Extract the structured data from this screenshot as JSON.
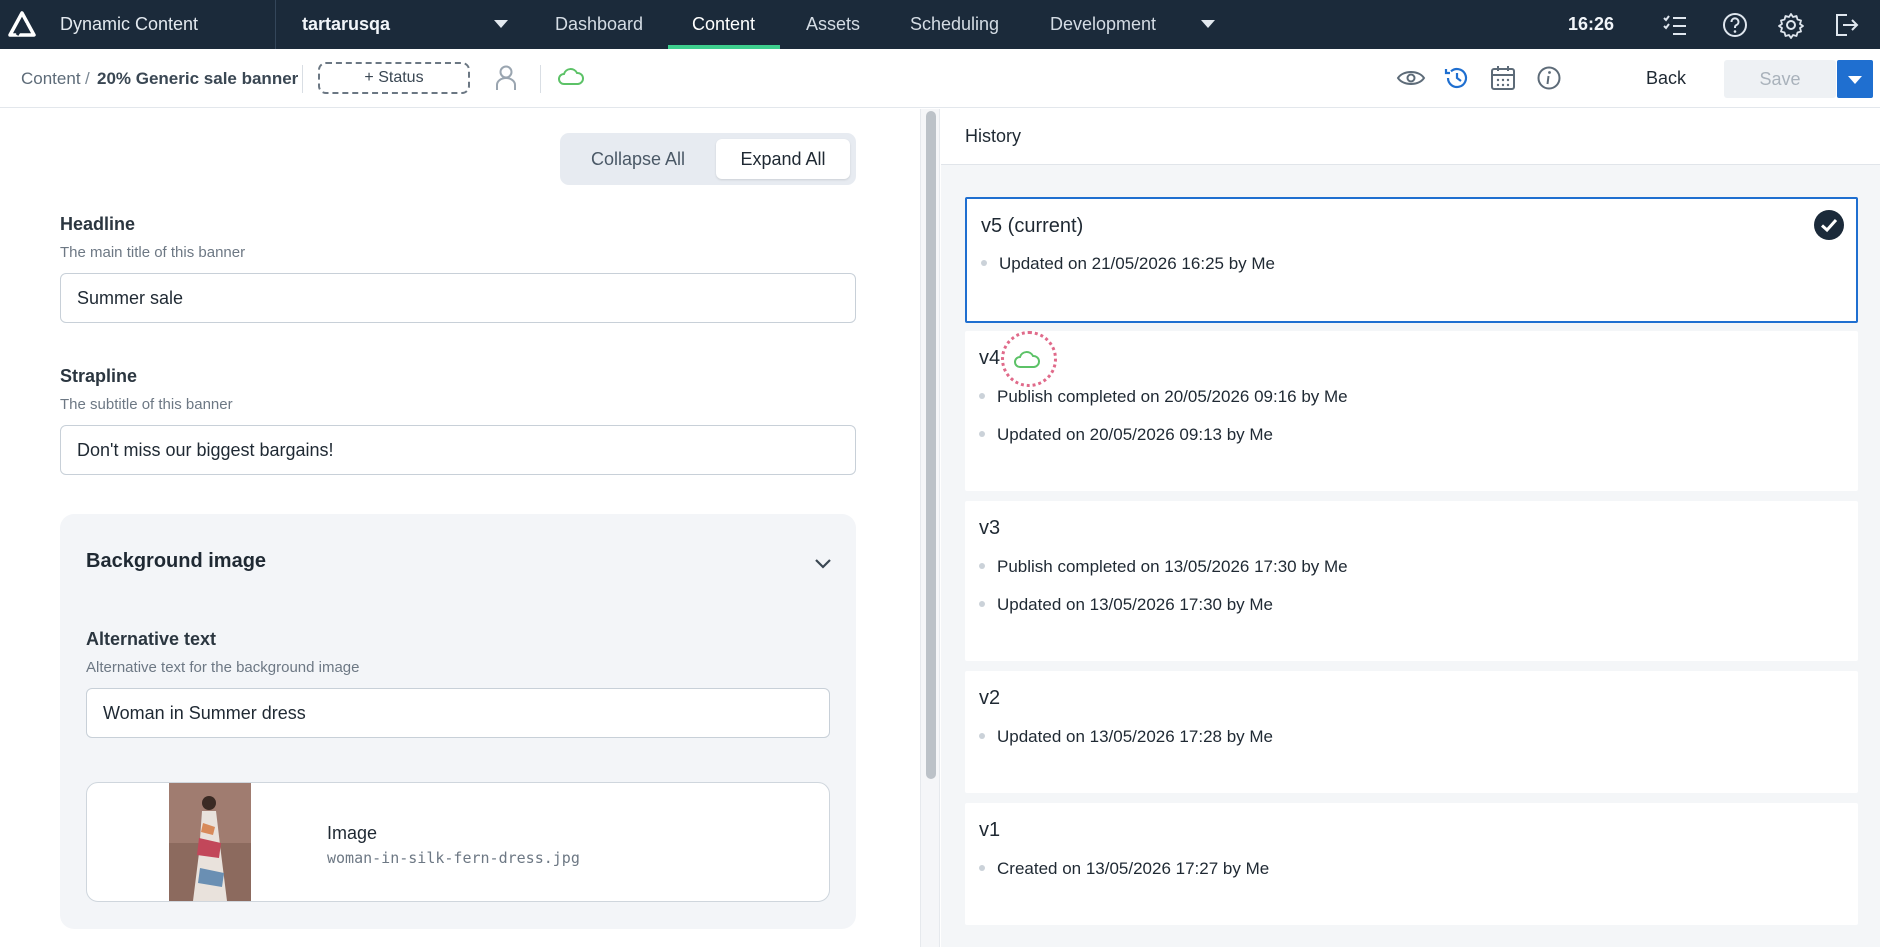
{
  "topnav": {
    "app_title": "Dynamic Content",
    "hub_name": "tartarusqa",
    "links": [
      "Dashboard",
      "Content",
      "Assets",
      "Scheduling",
      "Development"
    ],
    "active": "Content",
    "clock": "16:26",
    "icons": [
      "tasks-icon",
      "help-icon",
      "gear-icon",
      "logout-icon"
    ]
  },
  "toolbar": {
    "breadcrumb_root": "Content",
    "breadcrumb_sep": "/",
    "breadcrumb_current": "20% Generic sale banner",
    "status_label": "+ Status",
    "back_label": "Back",
    "save_label": "Save"
  },
  "editor": {
    "collapse_label": "Collapse All",
    "expand_label": "Expand All",
    "headline": {
      "label": "Headline",
      "help": "The main title of this banner",
      "value": "Summer sale"
    },
    "strapline": {
      "label": "Strapline",
      "help": "The subtitle of this banner",
      "value": "Don't miss our biggest bargains!"
    },
    "background": {
      "title": "Background image",
      "alt": {
        "label": "Alternative text",
        "help": "Alternative text for the background image",
        "value": "Woman in Summer dress"
      },
      "image": {
        "label": "Image",
        "filename": "woman-in-silk-fern-dress.jpg"
      }
    }
  },
  "history": {
    "title": "History",
    "versions": [
      {
        "title": "v5 (current)",
        "events": [
          "Updated on 21/05/2026 16:25 by Me"
        ]
      },
      {
        "title": "v4",
        "events": [
          "Publish completed on 20/05/2026 09:16 by Me",
          "Updated on 20/05/2026 09:13 by Me"
        ]
      },
      {
        "title": "v3",
        "events": [
          "Publish completed on 13/05/2026 17:30 by Me",
          "Updated on 13/05/2026 17:30 by Me"
        ]
      },
      {
        "title": "v2",
        "events": [
          "Updated on 13/05/2026 17:28 by Me"
        ]
      },
      {
        "title": "v1",
        "events": [
          "Created on 13/05/2026 17:27 by Me"
        ]
      }
    ]
  },
  "colors": {
    "nav_bg": "#1b2a3a",
    "accent": "#3ecf8e",
    "primary": "#1f6fd0",
    "published_cloud": "#5cc267"
  }
}
